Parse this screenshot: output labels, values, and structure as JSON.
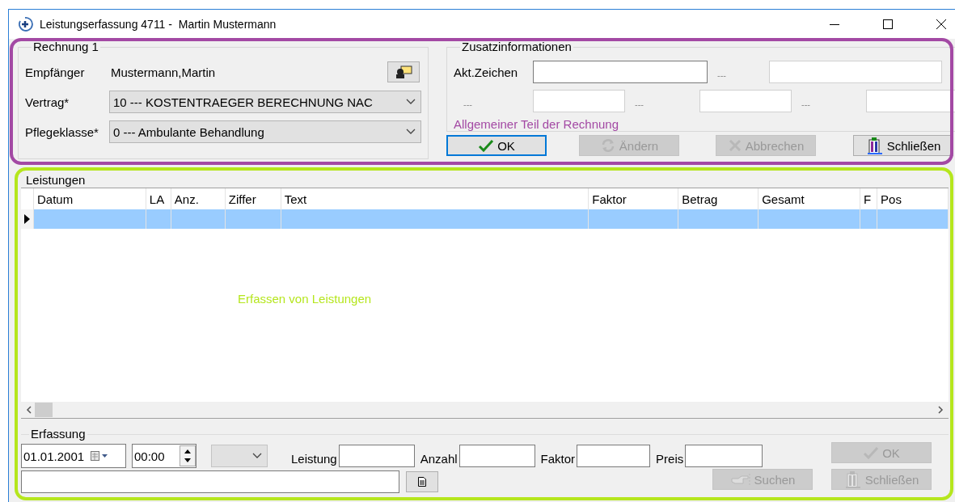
{
  "window": {
    "title": "Leistungserfassung 4711 -  Martin Mustermann"
  },
  "rechnung": {
    "title": "Rechnung 1",
    "fields": [
      {
        "kind": "text",
        "label": "Empfänger",
        "value": "Mustermann,Martin"
      },
      {
        "kind": "select",
        "label": "Vertrag*",
        "value": "10 --- KOSTENTRAEGER BERECHNUNG NAC"
      },
      {
        "kind": "select",
        "label": "Pflegeklasse*",
        "value": "0 --- Ambulante Behandlung"
      }
    ]
  },
  "zusatz": {
    "title": "Zusatzinformationen",
    "rows": [
      [
        {
          "label": "Akt.Zeichen",
          "focused": true
        },
        {
          "label": "---",
          "focused": false
        }
      ],
      [
        {
          "label": "---",
          "focused": false
        },
        {
          "label": "---",
          "focused": false
        },
        {
          "label": "---",
          "focused": false
        }
      ]
    ]
  },
  "actions": [
    {
      "kind": "ok",
      "label": "OK",
      "focused": true,
      "disabled": false
    },
    {
      "kind": "change",
      "label": "Ändern",
      "focused": false,
      "disabled": true
    },
    {
      "kind": "cancel",
      "label": "Abbrechen",
      "focused": false,
      "disabled": true
    },
    {
      "kind": "close",
      "label": "Schließen",
      "focused": false,
      "disabled": false
    }
  ],
  "leistungen": {
    "title": "Leistungen",
    "columns": [
      {
        "label": "Datum"
      },
      {
        "label": "LA"
      },
      {
        "label": "Anz."
      },
      {
        "label": "Ziffer"
      },
      {
        "label": "Text"
      },
      {
        "label": "Faktor"
      },
      {
        "label": "Betrag"
      },
      {
        "label": "Gesamt"
      },
      {
        "label": "F"
      },
      {
        "label": "Pos"
      }
    ],
    "rows": [
      {
        "selected": true
      }
    ]
  },
  "erfassung": {
    "title": "Erfassung",
    "date": "01.01.2001",
    "time": "00:00",
    "combo_disabled": true,
    "fields": [
      {
        "label": "Leistung"
      },
      {
        "label": "Anzahl"
      },
      {
        "label": "Faktor"
      },
      {
        "label": "Preis"
      }
    ],
    "buttons": [
      {
        "kind": "ok",
        "label": "OK",
        "disabled": true
      },
      {
        "kind": "search",
        "label": "Suchen",
        "disabled": true
      },
      {
        "kind": "close",
        "label": "Schließen",
        "disabled": true
      }
    ]
  },
  "annotations": [
    {
      "text": "Allgemeiner Teil der Rechnung",
      "color": "#a349a4"
    },
    {
      "text": "Erfassen von Leistungen",
      "color": "#b5e61d"
    }
  ]
}
